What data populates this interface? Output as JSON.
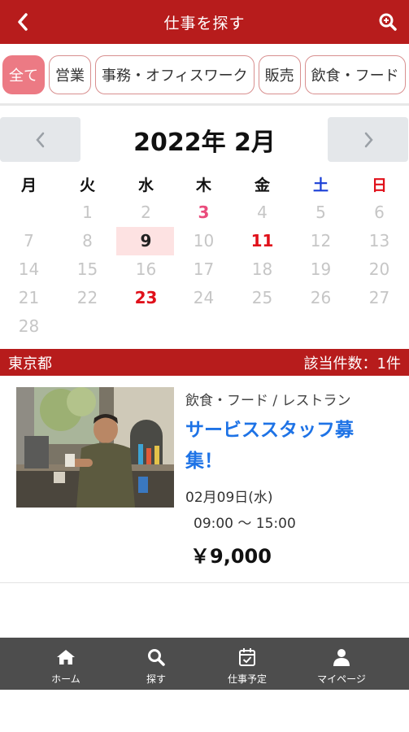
{
  "header": {
    "title": "仕事を探す"
  },
  "categories": [
    {
      "label": "全て",
      "active": true
    },
    {
      "label": "営業",
      "active": false
    },
    {
      "label": "事務・オフィスワーク",
      "active": false
    },
    {
      "label": "販売",
      "active": false
    },
    {
      "label": "飲食・フード",
      "active": false
    }
  ],
  "calendar": {
    "month_label": "2022年 2月",
    "weekdays": [
      "月",
      "火",
      "水",
      "木",
      "金",
      "土",
      "日"
    ],
    "weeks": [
      [
        null,
        "1",
        "2",
        "3",
        "4",
        "5",
        "6"
      ],
      [
        "7",
        "8",
        "9",
        "10",
        "11",
        "12",
        "13"
      ],
      [
        "14",
        "15",
        "16",
        "17",
        "18",
        "19",
        "20"
      ],
      [
        "21",
        "22",
        "23",
        "24",
        "25",
        "26",
        "27"
      ],
      [
        "28",
        null,
        null,
        null,
        null,
        null,
        null
      ]
    ],
    "selected_day": "9",
    "pink_days": [
      "3"
    ],
    "red_days": [
      "11",
      "23"
    ]
  },
  "area": {
    "name": "東京都",
    "count_label": "該当件数：1件"
  },
  "job": {
    "category": "飲食・フード / レストラン",
    "title_line1": "サービススタッフ募",
    "title_line2": "集！",
    "date": "02月09日(水)",
    "time": "09:00 ～ 15:00",
    "pay": "￥9,000"
  },
  "tabs": [
    {
      "label": "ホーム",
      "icon": "home-icon"
    },
    {
      "label": "探す",
      "icon": "search-icon"
    },
    {
      "label": "仕事予定",
      "icon": "calendar-check-icon"
    },
    {
      "label": "マイページ",
      "icon": "person-icon"
    }
  ],
  "colors": {
    "brand": "#b71c1c",
    "chip_active": "#ec7a84",
    "link": "#1e73e6",
    "tabbar": "#4d4d4d"
  }
}
